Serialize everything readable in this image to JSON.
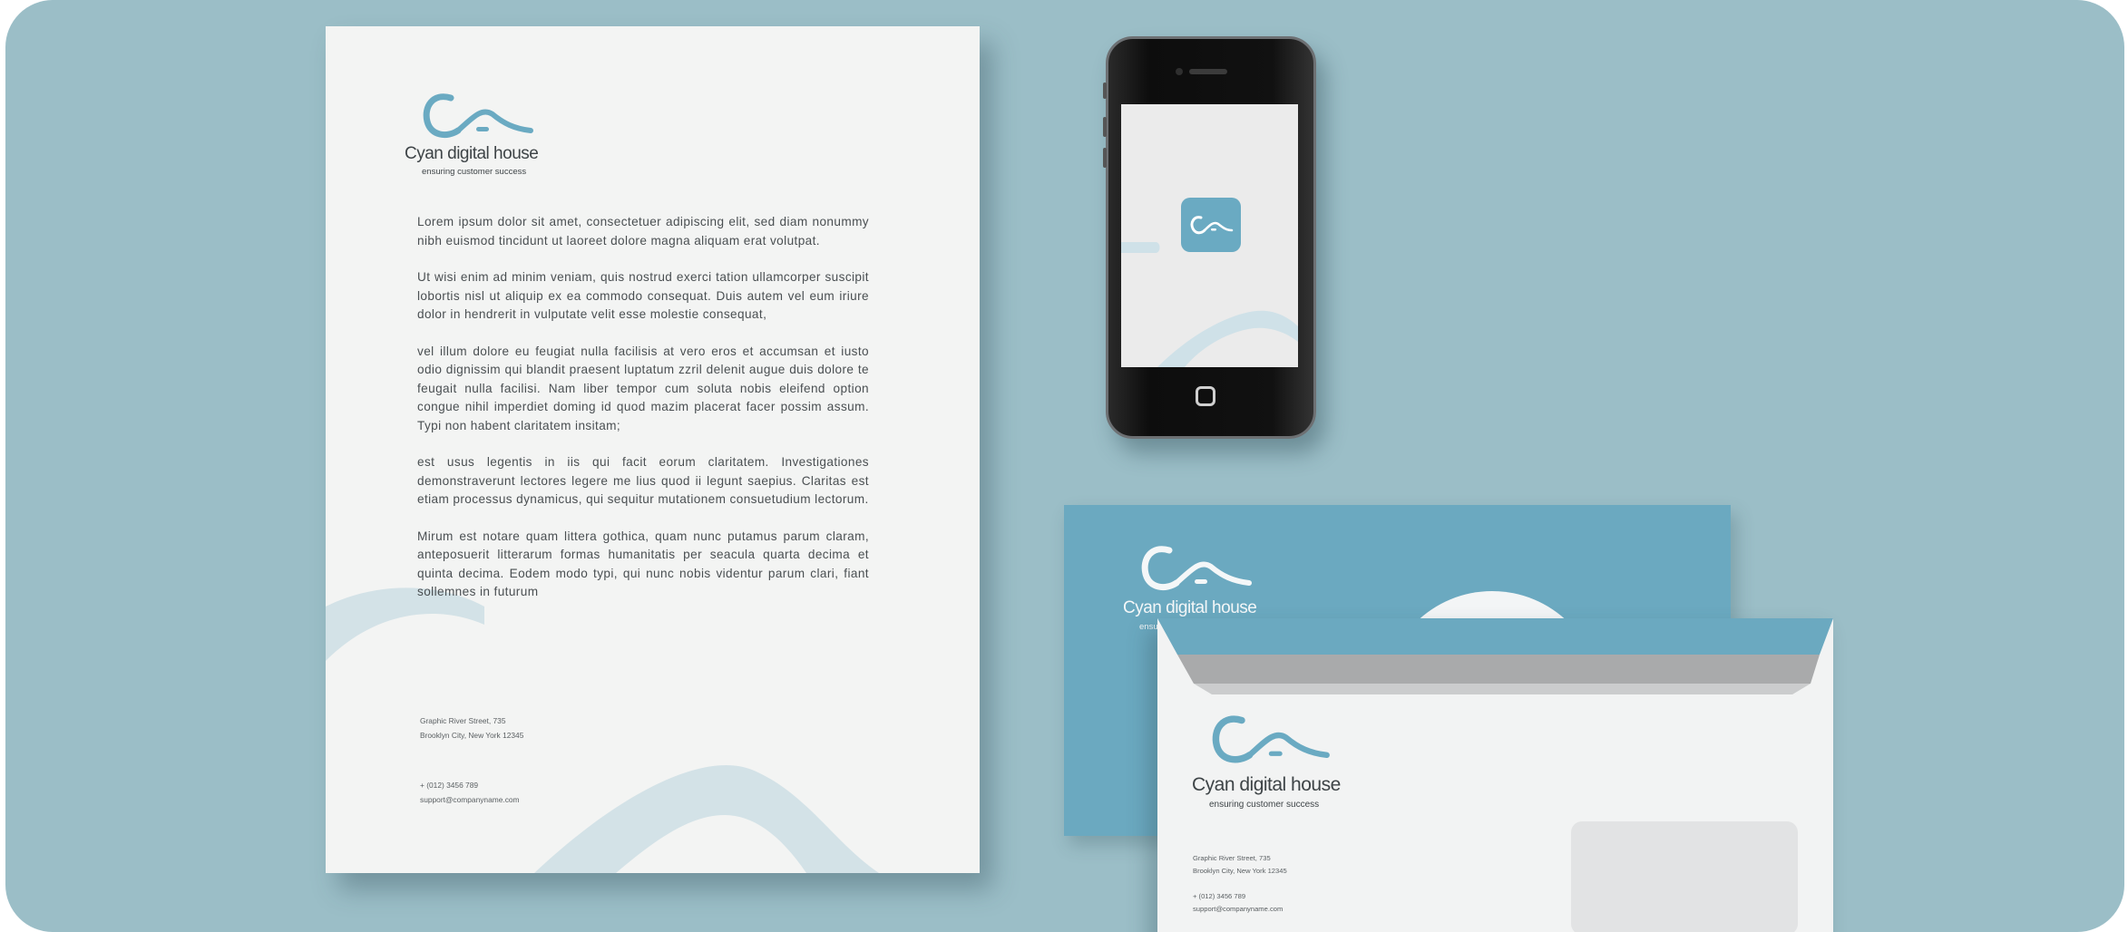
{
  "brand": {
    "name": "Cyan digital house",
    "tagline": "ensuring customer success",
    "accent_color": "#6aaac2",
    "background_color": "#9bbec7"
  },
  "letter": {
    "paragraphs": [
      "Lorem ipsum dolor sit amet, consectetuer adipiscing elit, sed diam nonummy nibh euismod tincidunt ut laoreet dolore magna aliquam erat volutpat.",
      "Ut wisi enim ad minim veniam, quis nostrud exerci tation ullamcorper suscipit lobortis nisl ut aliquip ex ea commodo consequat. Duis autem vel eum iriure dolor in hendrerit in vulputate velit esse molestie consequat,",
      "vel illum dolore eu feugiat nulla facilisis at vero eros et accumsan et iusto odio dignissim qui blandit praesent luptatum zzril delenit augue duis dolore te feugait nulla facilisi. Nam liber tempor cum soluta nobis eleifend option congue nihil imperdiet doming id quod mazim placerat facer possim assum. Typi non habent claritatem insitam;",
      "est usus legentis in iis qui facit eorum claritatem. Investigationes demonstraverunt lectores legere me lius quod ii legunt saepius. Claritas est etiam processus dynamicus, qui sequitur mutationem consuetudium lectorum.",
      "Mirum est notare quam littera gothica, quam nunc putamus parum claram, anteposuerit litterarum formas humanitatis per seacula quarta decima et quinta decima. Eodem modo typi, qui nunc nobis videntur parum clari, fiant sollemnes in futurum"
    ]
  },
  "contact": {
    "street": "Graphic River Street, 735",
    "city": "Brooklyn City, New York 12345",
    "phone": "+ (012) 3456 789",
    "email": "support@companyname.com"
  }
}
